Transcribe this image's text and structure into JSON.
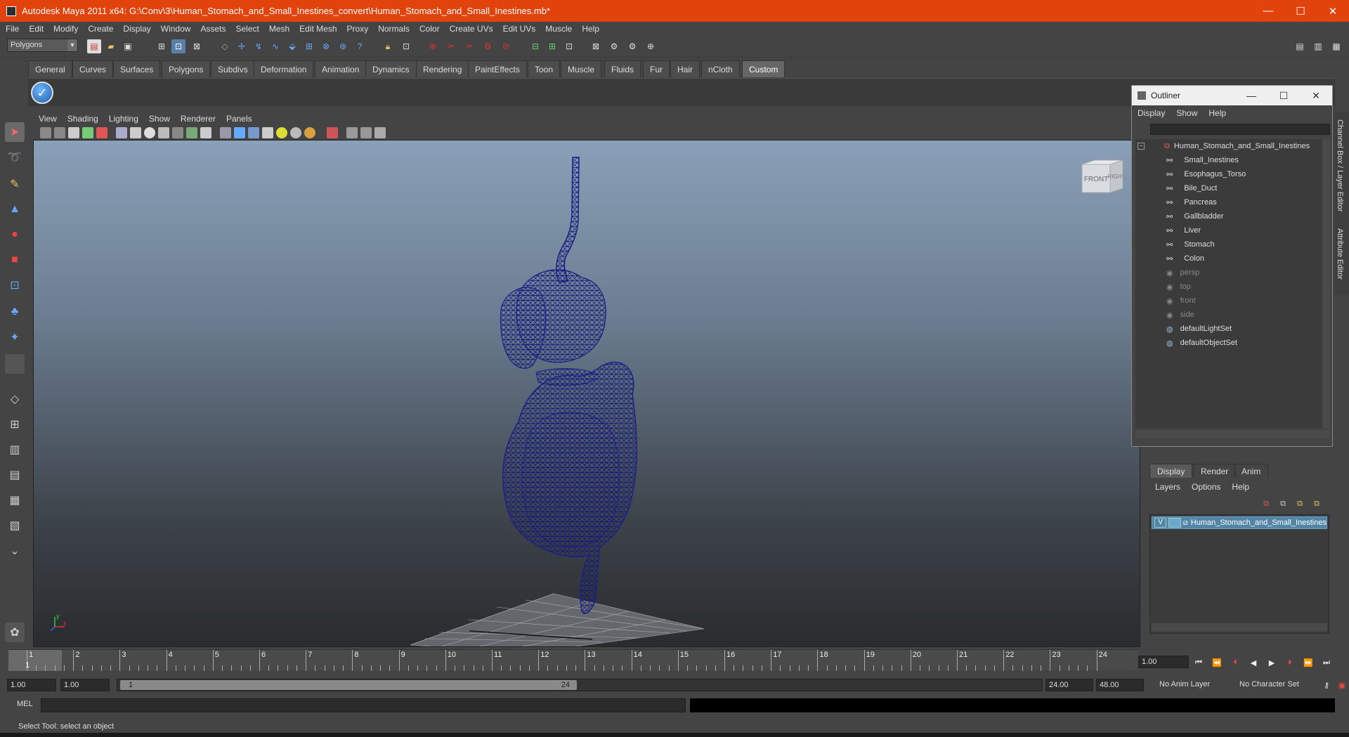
{
  "window": {
    "title": "Autodesk Maya 2011 x64: G:\\Conv\\3\\Human_Stomach_and_Small_Inestines_convert\\Human_Stomach_and_Small_Inestines.mb*",
    "minimize": "—",
    "maximize": "☐",
    "close": "✕"
  },
  "menubar": [
    "File",
    "Edit",
    "Modify",
    "Create",
    "Display",
    "Window",
    "Assets",
    "Select",
    "Mesh",
    "Edit Mesh",
    "Proxy",
    "Normals",
    "Color",
    "Create UVs",
    "Edit UVs",
    "Muscle",
    "Help"
  ],
  "status_line": {
    "mode": "Polygons"
  },
  "shelf": {
    "tabs": [
      "General",
      "Curves",
      "Surfaces",
      "Polygons",
      "Subdivs",
      "Deformation",
      "Animation",
      "Dynamics",
      "Rendering",
      "PaintEffects",
      "Toon",
      "Muscle",
      "Fluids",
      "Fur",
      "Hair",
      "nCloth",
      "Custom"
    ],
    "active_tab": "Custom"
  },
  "panel_menu": [
    "View",
    "Shading",
    "Lighting",
    "Show",
    "Renderer",
    "Panels"
  ],
  "viewcube": {
    "front": "FRONT",
    "right": "RIGHT"
  },
  "axis": {
    "x": "x",
    "y": "y"
  },
  "timeline": {
    "ticks": [
      "1",
      "2",
      "3",
      "4",
      "5",
      "6",
      "7",
      "8",
      "9",
      "10",
      "11",
      "12",
      "13",
      "14",
      "15",
      "16",
      "17",
      "18",
      "19",
      "20",
      "21",
      "22",
      "23",
      "24"
    ],
    "current_frame": "1",
    "current_time_field": "1.00"
  },
  "range": {
    "start": "1.00",
    "playback_start": "1.00",
    "slider_start": "1",
    "slider_end": "24",
    "playback_end": "24.00",
    "end": "48.00",
    "anim_layer": "No Anim Layer",
    "character_set": "No Character Set"
  },
  "command_line": {
    "label": "MEL"
  },
  "help_line": "Select Tool: select an object",
  "outliner": {
    "title": "Outliner",
    "menu": [
      "Display",
      "Show",
      "Help"
    ],
    "root": "Human_Stomach_and_Small_Inestines",
    "children": [
      "Small_Inestines",
      "Esophagus_Torso",
      "Bile_Duct",
      "Pancreas",
      "Gallbladder",
      "Liver",
      "Stomach",
      "Colon"
    ],
    "cameras": [
      "persp",
      "top",
      "front",
      "side"
    ],
    "sets": [
      "defaultLightSet",
      "defaultObjectSet"
    ]
  },
  "layer_editor": {
    "tabs": [
      "Display",
      "Render",
      "Anim"
    ],
    "active_tab": "Display",
    "menu": [
      "Layers",
      "Options",
      "Help"
    ],
    "layer": {
      "visible": "V",
      "name": "Human_Stomach_and_Small_Inestines"
    }
  },
  "side_tabs": [
    "Channel Box / Layer Editor",
    "Attribute Editor"
  ],
  "colors": {
    "title_bar": "#e2430d",
    "wire": "#1a1f8a",
    "selection": "#5285a6"
  }
}
